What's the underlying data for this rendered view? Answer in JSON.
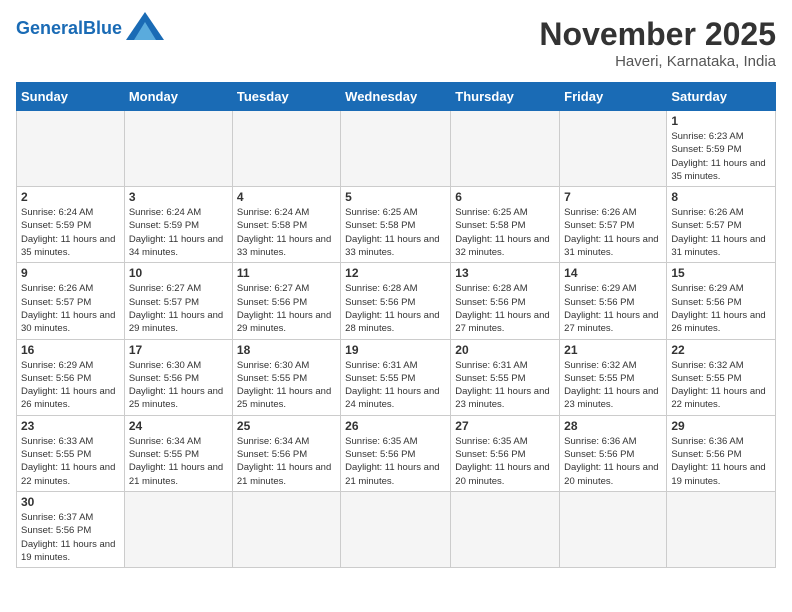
{
  "header": {
    "logo_general": "General",
    "logo_blue": "Blue",
    "month": "November 2025",
    "location": "Haveri, Karnataka, India"
  },
  "weekdays": [
    "Sunday",
    "Monday",
    "Tuesday",
    "Wednesday",
    "Thursday",
    "Friday",
    "Saturday"
  ],
  "weeks": [
    [
      {
        "day": "",
        "info": ""
      },
      {
        "day": "",
        "info": ""
      },
      {
        "day": "",
        "info": ""
      },
      {
        "day": "",
        "info": ""
      },
      {
        "day": "",
        "info": ""
      },
      {
        "day": "",
        "info": ""
      },
      {
        "day": "1",
        "info": "Sunrise: 6:23 AM\nSunset: 5:59 PM\nDaylight: 11 hours\nand 35 minutes."
      }
    ],
    [
      {
        "day": "2",
        "info": "Sunrise: 6:24 AM\nSunset: 5:59 PM\nDaylight: 11 hours\nand 35 minutes."
      },
      {
        "day": "3",
        "info": "Sunrise: 6:24 AM\nSunset: 5:59 PM\nDaylight: 11 hours\nand 34 minutes."
      },
      {
        "day": "4",
        "info": "Sunrise: 6:24 AM\nSunset: 5:58 PM\nDaylight: 11 hours\nand 33 minutes."
      },
      {
        "day": "5",
        "info": "Sunrise: 6:25 AM\nSunset: 5:58 PM\nDaylight: 11 hours\nand 33 minutes."
      },
      {
        "day": "6",
        "info": "Sunrise: 6:25 AM\nSunset: 5:58 PM\nDaylight: 11 hours\nand 32 minutes."
      },
      {
        "day": "7",
        "info": "Sunrise: 6:26 AM\nSunset: 5:57 PM\nDaylight: 11 hours\nand 31 minutes."
      },
      {
        "day": "8",
        "info": "Sunrise: 6:26 AM\nSunset: 5:57 PM\nDaylight: 11 hours\nand 31 minutes."
      }
    ],
    [
      {
        "day": "9",
        "info": "Sunrise: 6:26 AM\nSunset: 5:57 PM\nDaylight: 11 hours\nand 30 minutes."
      },
      {
        "day": "10",
        "info": "Sunrise: 6:27 AM\nSunset: 5:57 PM\nDaylight: 11 hours\nand 29 minutes."
      },
      {
        "day": "11",
        "info": "Sunrise: 6:27 AM\nSunset: 5:56 PM\nDaylight: 11 hours\nand 29 minutes."
      },
      {
        "day": "12",
        "info": "Sunrise: 6:28 AM\nSunset: 5:56 PM\nDaylight: 11 hours\nand 28 minutes."
      },
      {
        "day": "13",
        "info": "Sunrise: 6:28 AM\nSunset: 5:56 PM\nDaylight: 11 hours\nand 27 minutes."
      },
      {
        "day": "14",
        "info": "Sunrise: 6:29 AM\nSunset: 5:56 PM\nDaylight: 11 hours\nand 27 minutes."
      },
      {
        "day": "15",
        "info": "Sunrise: 6:29 AM\nSunset: 5:56 PM\nDaylight: 11 hours\nand 26 minutes."
      }
    ],
    [
      {
        "day": "16",
        "info": "Sunrise: 6:29 AM\nSunset: 5:56 PM\nDaylight: 11 hours\nand 26 minutes."
      },
      {
        "day": "17",
        "info": "Sunrise: 6:30 AM\nSunset: 5:56 PM\nDaylight: 11 hours\nand 25 minutes."
      },
      {
        "day": "18",
        "info": "Sunrise: 6:30 AM\nSunset: 5:55 PM\nDaylight: 11 hours\nand 25 minutes."
      },
      {
        "day": "19",
        "info": "Sunrise: 6:31 AM\nSunset: 5:55 PM\nDaylight: 11 hours\nand 24 minutes."
      },
      {
        "day": "20",
        "info": "Sunrise: 6:31 AM\nSunset: 5:55 PM\nDaylight: 11 hours\nand 23 minutes."
      },
      {
        "day": "21",
        "info": "Sunrise: 6:32 AM\nSunset: 5:55 PM\nDaylight: 11 hours\nand 23 minutes."
      },
      {
        "day": "22",
        "info": "Sunrise: 6:32 AM\nSunset: 5:55 PM\nDaylight: 11 hours\nand 22 minutes."
      }
    ],
    [
      {
        "day": "23",
        "info": "Sunrise: 6:33 AM\nSunset: 5:55 PM\nDaylight: 11 hours\nand 22 minutes."
      },
      {
        "day": "24",
        "info": "Sunrise: 6:34 AM\nSunset: 5:55 PM\nDaylight: 11 hours\nand 21 minutes."
      },
      {
        "day": "25",
        "info": "Sunrise: 6:34 AM\nSunset: 5:56 PM\nDaylight: 11 hours\nand 21 minutes."
      },
      {
        "day": "26",
        "info": "Sunrise: 6:35 AM\nSunset: 5:56 PM\nDaylight: 11 hours\nand 21 minutes."
      },
      {
        "day": "27",
        "info": "Sunrise: 6:35 AM\nSunset: 5:56 PM\nDaylight: 11 hours\nand 20 minutes."
      },
      {
        "day": "28",
        "info": "Sunrise: 6:36 AM\nSunset: 5:56 PM\nDaylight: 11 hours\nand 20 minutes."
      },
      {
        "day": "29",
        "info": "Sunrise: 6:36 AM\nSunset: 5:56 PM\nDaylight: 11 hours\nand 19 minutes."
      }
    ],
    [
      {
        "day": "30",
        "info": "Sunrise: 6:37 AM\nSunset: 5:56 PM\nDaylight: 11 hours\nand 19 minutes."
      },
      {
        "day": "",
        "info": ""
      },
      {
        "day": "",
        "info": ""
      },
      {
        "day": "",
        "info": ""
      },
      {
        "day": "",
        "info": ""
      },
      {
        "day": "",
        "info": ""
      },
      {
        "day": "",
        "info": ""
      }
    ]
  ]
}
